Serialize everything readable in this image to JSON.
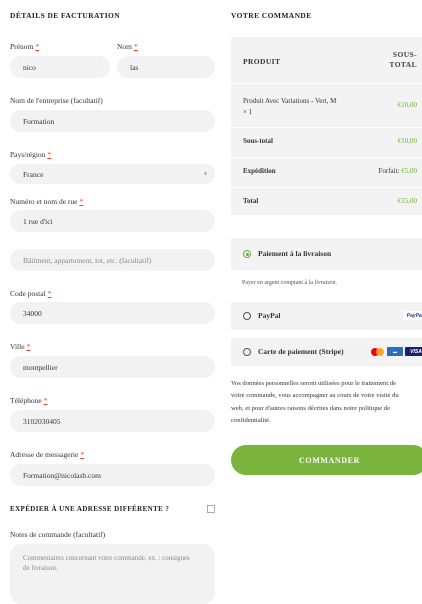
{
  "billing": {
    "title": "DÉTAILS DE FACTURATION",
    "prenom_label": "Prénom",
    "prenom_value": "nico",
    "nom_label": "Nom",
    "nom_value": "las",
    "company_label": "Nom de l'entreprise (facultatif)",
    "company_value": "Formation",
    "country_label": "Pays/région",
    "country_value": "France",
    "street_label": "Numéro et nom de rue",
    "street_value": "1 rue d'ici",
    "street2_placeholder": "Bâtiment, appartement, lot, etc. (facultatif)",
    "postcode_label": "Code postal",
    "postcode_value": "34000",
    "city_label": "Ville",
    "city_value": "montpellier",
    "phone_label": "Téléphone",
    "phone_value": "3102030405",
    "email_label": "Adresse de messagerie",
    "email_value": "Formation@nicolasb.com",
    "required_mark": "*"
  },
  "shipping": {
    "toggle_label": "EXPÉDIER À UNE ADRESSE DIFFÉRENTE ?"
  },
  "notes": {
    "label": "Notes de commande (facultatif)",
    "placeholder_line1": "Commentaires concernant votre commande, ex. : consignes",
    "placeholder_line2": "de livraison."
  },
  "order": {
    "title": "VOTRE COMMANDE",
    "col_product": "PRODUIT",
    "col_subtotal_1": "SOUS-",
    "col_subtotal_2": "TOTAL",
    "item_line1": "Produit Avec Variations - Vert, M",
    "item_line2": "× 1",
    "item_total": "€10,00",
    "subtotal_label": "Sous-total",
    "subtotal_value": "€10,00",
    "shipping_label": "Expédition",
    "shipping_prefix": "Forfait:",
    "shipping_value": "€5,00",
    "total_label": "Total",
    "total_value": "€15,00"
  },
  "payment": {
    "cod_label": "Paiement à la livraison",
    "cod_desc": "Payer en argent comptant à la livraison.",
    "paypal_label": "PayPal",
    "paypal_logo": "PayPal",
    "stripe_label": "Carte de paiement (Stripe)",
    "visa_text": "VISA",
    "privacy_text_1": "Vos données personnelles seront utilisées pour le traitement de",
    "privacy_text_2": "votre commande, vous accompagner au cours de votre visite du",
    "privacy_text_3": "web, et pour d'autres raisons décrites dans notre politique de",
    "privacy_text_4": "confidentialité.",
    "button_label": "COMMANDER"
  },
  "colors": {
    "accent_green": "#7bb43c",
    "required_red": "#e2401c",
    "field_bg": "#f2f2f2"
  }
}
